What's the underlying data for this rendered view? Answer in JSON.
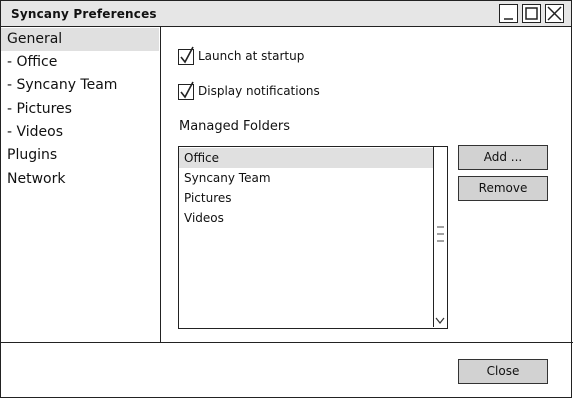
{
  "window": {
    "title": "Syncany Preferences",
    "controls": {
      "minimize_icon": "minimize-icon",
      "maximize_icon": "maximize-icon",
      "close_icon": "close-icon"
    }
  },
  "sidebar": {
    "items": [
      {
        "label": "General",
        "selected": true
      },
      {
        "label": "- Office"
      },
      {
        "label": "- Syncany Team"
      },
      {
        "label": "- Pictures"
      },
      {
        "label": "- Videos"
      },
      {
        "label": "Plugins"
      },
      {
        "label": "Network"
      }
    ]
  },
  "general": {
    "launch_at_startup": {
      "label": "Launch at startup",
      "checked": true
    },
    "display_notifications": {
      "label": "Display notifications",
      "checked": true
    },
    "managed_folders_label": "Managed Folders",
    "folders": [
      {
        "name": "Office",
        "selected": true
      },
      {
        "name": "Syncany Team"
      },
      {
        "name": "Pictures"
      },
      {
        "name": "Videos"
      }
    ],
    "add_button": "Add ...",
    "remove_button": "Remove"
  },
  "footer": {
    "close_button": "Close"
  }
}
